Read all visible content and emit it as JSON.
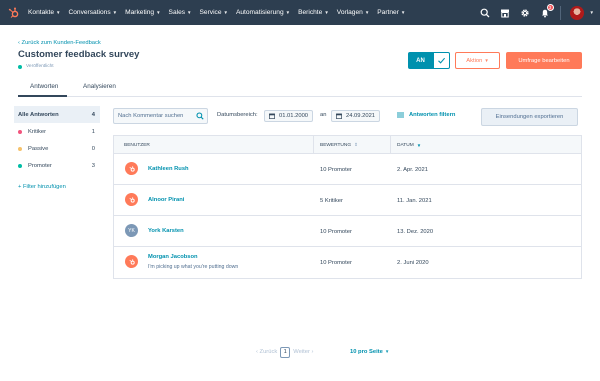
{
  "nav": {
    "items": [
      {
        "label": "Kontakte"
      },
      {
        "label": "Conversations"
      },
      {
        "label": "Marketing"
      },
      {
        "label": "Sales"
      },
      {
        "label": "Service"
      },
      {
        "label": "Automatisierung"
      },
      {
        "label": "Berichte"
      },
      {
        "label": "Vorlagen"
      },
      {
        "label": "Partner"
      }
    ],
    "notification_count": "3",
    "brand_color": "#ff7a59",
    "bar_color": "#2d3e50"
  },
  "header": {
    "back_link": "Zurück zum Kunden-Feedback",
    "title": "Customer feedback survey",
    "status": "Veröffentlicht",
    "toggle_label": "AN",
    "action_button": "Aktion",
    "edit_button": "Umfrage bearbeiten"
  },
  "tabs": [
    {
      "label": "Antworten",
      "active": true
    },
    {
      "label": "Analysieren",
      "active": false
    }
  ],
  "sidebar": {
    "items": [
      {
        "label": "Alle Antworten",
        "count": "4",
        "color": "",
        "active": true
      },
      {
        "label": "Kritiker",
        "count": "1",
        "color": "#f2547d",
        "active": false
      },
      {
        "label": "Passive",
        "count": "0",
        "color": "#f5c26b",
        "active": false
      },
      {
        "label": "Promoter",
        "count": "3",
        "color": "#00bda5",
        "active": false
      }
    ],
    "add_filter": "Filter hinzufügen"
  },
  "toolbar": {
    "search_placeholder": "Nach Kommentar suchen",
    "date_range_label": "Datumsbereich:",
    "date_from": "01.01.2000",
    "date_between": "an",
    "date_to": "24.09.2021",
    "filter_link": "Antworten filtern",
    "export_button": "Einsendungen exportieren"
  },
  "table": {
    "columns": [
      "BENUTZER",
      "BEWERTUNG",
      "DATUM"
    ],
    "rows": [
      {
        "avatar": "hubspot-icon",
        "initials": "",
        "name": "Kathleen Rush",
        "comment": "",
        "rating": "10 Promoter",
        "date": "2. Apr. 2021"
      },
      {
        "avatar": "hubspot-icon",
        "initials": "",
        "name": "Alnoor Pirani",
        "comment": "",
        "rating": "5 Kritiker",
        "date": "11. Jan. 2021"
      },
      {
        "avatar": "initials",
        "initials": "YK",
        "name": "York Karsten",
        "comment": "",
        "rating": "10 Promoter",
        "date": "13. Dez. 2020"
      },
      {
        "avatar": "hubspot-icon",
        "initials": "",
        "name": "Morgan Jacobson",
        "comment": "I'm picking up what you're putting down",
        "rating": "10 Promoter",
        "date": "2. Juni 2020"
      }
    ]
  },
  "pagination": {
    "prev": "Zurück",
    "page": "1",
    "next": "Weiter",
    "per_page": "10 pro Seite"
  }
}
